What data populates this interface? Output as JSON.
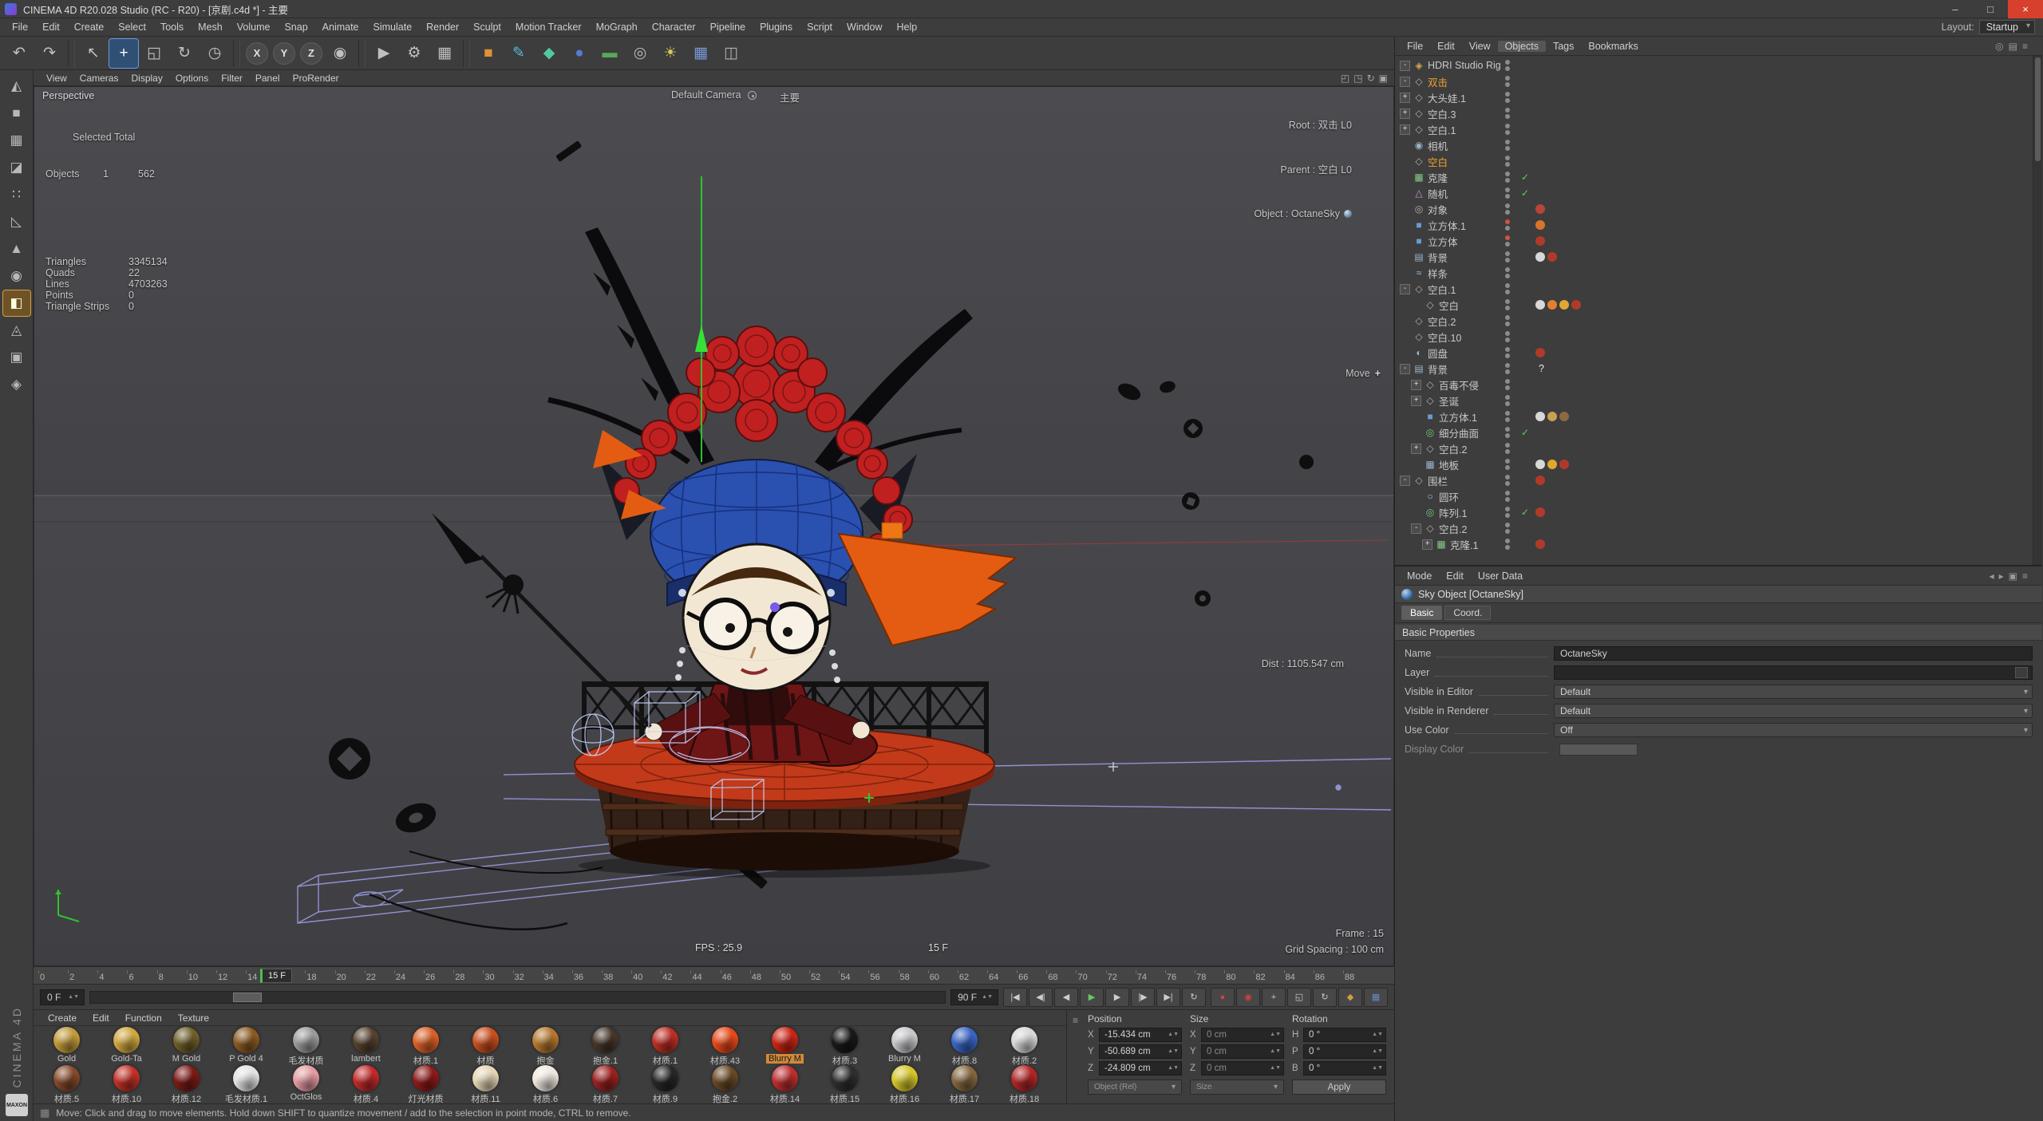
{
  "window": {
    "title": "CINEMA 4D R20.028 Studio (RC - R20) - [京剧.c4d *] - 主要",
    "buttons": [
      {
        "n": "minimize-button",
        "g": "–"
      },
      {
        "n": "maximize-button",
        "g": "□"
      },
      {
        "n": "close-button",
        "g": "×",
        "k": "close"
      }
    ]
  },
  "menubar": {
    "items": [
      "File",
      "Edit",
      "Create",
      "Select",
      "Tools",
      "Mesh",
      "Volume",
      "Snap",
      "Animate",
      "Simulate",
      "Render",
      "Sculpt",
      "Motion Tracker",
      "MoGraph",
      "Character",
      "Pipeline",
      "Plugins",
      "Script",
      "Window",
      "Help"
    ],
    "layout_label": "Layout:",
    "layout_value": "Startup"
  },
  "toolbar": {
    "items": [
      {
        "n": "undo-icon",
        "g": "↶"
      },
      {
        "n": "redo-icon",
        "g": "↷"
      },
      {
        "k": "sep"
      },
      {
        "n": "live-selection-icon",
        "g": "↖"
      },
      {
        "n": "move-tool-icon",
        "g": "+",
        "k": "active"
      },
      {
        "n": "scale-tool-icon",
        "g": "◱"
      },
      {
        "n": "rotate-tool-icon",
        "g": "↻"
      },
      {
        "n": "last-tool-icon",
        "g": "◷"
      },
      {
        "k": "sep"
      },
      {
        "n": "lock-x-axis",
        "g": "X",
        "k": "axis"
      },
      {
        "n": "lock-y-axis",
        "g": "Y",
        "k": "axis"
      },
      {
        "n": "lock-z-axis",
        "g": "Z",
        "k": "axis"
      },
      {
        "n": "coord-system-icon",
        "g": "◉"
      },
      {
        "k": "sep"
      },
      {
        "n": "render-view-icon",
        "g": "▶"
      },
      {
        "n": "render-settings-icon",
        "g": "⚙"
      },
      {
        "n": "render-queue-icon",
        "g": "▦"
      },
      {
        "k": "sep"
      },
      {
        "n": "primitive-cube-icon",
        "g": "■",
        "c": "#e09038"
      },
      {
        "n": "spline-pen-icon",
        "g": "✎",
        "c": "#58b8d8"
      },
      {
        "n": "mograph-icon",
        "g": "◆",
        "c": "#50c8a0"
      },
      {
        "n": "deformer-icon",
        "g": "●",
        "c": "#5878d8"
      },
      {
        "n": "environment-icon",
        "g": "▬",
        "c": "#58a858"
      },
      {
        "n": "camera-tool-icon",
        "g": "◎",
        "c": "#b8b8b8"
      },
      {
        "n": "light-tool-icon",
        "g": "☀",
        "c": "#d8c858"
      },
      {
        "n": "array-tool-icon",
        "g": "▦",
        "c": "#7898d8"
      },
      {
        "n": "display-mode-icon",
        "g": "◫",
        "c": "#b0b0b0"
      }
    ]
  },
  "side_toolbar": {
    "items": [
      {
        "n": "make-editable-icon",
        "g": "◭"
      },
      {
        "n": "model-mode-icon",
        "g": "■"
      },
      {
        "n": "texture-mode-icon",
        "g": "▦"
      },
      {
        "n": "workplane-mode-icon",
        "g": "◪"
      },
      {
        "n": "points-mode-icon",
        "g": "∷"
      },
      {
        "n": "edges-mode-icon",
        "g": "◺"
      },
      {
        "n": "polygons-mode-icon",
        "g": "▲"
      },
      {
        "n": "enable-axis-icon",
        "g": "◉"
      },
      {
        "n": "viewport-solo-icon",
        "g": "◧",
        "k": "active"
      },
      {
        "n": "snap-icon",
        "g": "◬"
      },
      {
        "n": "lock-workplane-icon",
        "g": "▣"
      },
      {
        "n": "quantize-icon",
        "g": "◈"
      }
    ]
  },
  "viewport": {
    "menu": [
      "View",
      "Cameras",
      "Display",
      "Options",
      "Filter",
      "Panel",
      "ProRender"
    ],
    "right_icons": [
      {
        "n": "pan-view-icon",
        "g": "◰"
      },
      {
        "n": "zoom-view-icon",
        "g": "◳"
      },
      {
        "n": "rotate-view-icon",
        "g": "↻"
      },
      {
        "n": "toggle-views-icon",
        "g": "▣"
      }
    ],
    "view_label": "Perspective",
    "camera_label": "Default Camera",
    "camera_tag": "主要",
    "hud": {
      "root": "Root : 双击 L0",
      "parent": "Parent : 空白 L0",
      "object": "Object : OctaneSky",
      "move": "Move",
      "dist": "Dist : 1105.547 cm",
      "fps": "FPS : 25.9",
      "frame_center": "15 F",
      "frame": "Frame : 15",
      "grid": "Grid Spacing : 100 cm"
    },
    "stats": {
      "title": "Selected Total",
      "objects_label": "Objects",
      "objects_sel": "1",
      "objects_total": "562",
      "rows": [
        [
          "Triangles",
          "3345134"
        ],
        [
          "Quads",
          "22"
        ],
        [
          "Lines",
          "4703263"
        ],
        [
          "Points",
          "0"
        ],
        [
          "Triangle Strips",
          "0"
        ]
      ]
    }
  },
  "timeline": {
    "ticks": [
      "0",
      "2",
      "4",
      "6",
      "8",
      "10",
      "12",
      "14",
      "16",
      "18",
      "20",
      "22",
      "24",
      "26",
      "28",
      "30",
      "32",
      "34",
      "36",
      "38",
      "40",
      "42",
      "44",
      "46",
      "48",
      "50",
      "52",
      "54",
      "56",
      "58",
      "60",
      "62",
      "64",
      "66",
      "68",
      "70",
      "72",
      "74",
      "76",
      "78",
      "80",
      "82",
      "84",
      "86",
      "88"
    ],
    "marker": "15 F",
    "start": "0 F",
    "end": "90 F",
    "transport": [
      {
        "n": "goto-start-icon",
        "g": "|◀"
      },
      {
        "n": "prev-key-icon",
        "g": "◀|"
      },
      {
        "n": "prev-frame-icon",
        "g": "◀"
      },
      {
        "n": "play-icon",
        "g": "▶",
        "c": "#68c868"
      },
      {
        "n": "next-frame-icon",
        "g": "▶"
      },
      {
        "n": "next-key-icon",
        "g": "|▶"
      },
      {
        "n": "goto-end-icon",
        "g": "▶|"
      },
      {
        "n": "loop-icon",
        "g": "↻"
      }
    ],
    "record": [
      {
        "n": "record-keyframe-icon",
        "g": "●",
        "c": "#d24040"
      },
      {
        "n": "autokey-icon",
        "g": "◉",
        "c": "#d24040"
      },
      {
        "n": "record-position-icon",
        "g": "+",
        "c": "#c8c8c8"
      },
      {
        "n": "record-scale-icon",
        "g": "◱",
        "c": "#c8c8c8"
      },
      {
        "n": "record-rotation-icon",
        "g": "↻",
        "c": "#c8c8c8"
      },
      {
        "n": "record-parameter-icon",
        "g": "◆",
        "c": "#d0a040"
      },
      {
        "n": "record-pla-icon",
        "g": "▦",
        "c": "#6888c8"
      }
    ]
  },
  "materials": {
    "menu": [
      "Create",
      "Edit",
      "Function",
      "Texture"
    ],
    "items": [
      {
        "n": "Gold",
        "c": "#c09a3a"
      },
      {
        "n": "Gold-Ta",
        "c": "#cfa63f"
      },
      {
        "n": "M Gold",
        "c": "#6e5e2a"
      },
      {
        "n": "P Gold 4",
        "c": "#8a5a22"
      },
      {
        "n": "毛发材质",
        "c": "#9a9a9a"
      },
      {
        "n": "lambert",
        "c": "#54422e"
      },
      {
        "n": "材质.1",
        "c": "#d96026"
      },
      {
        "n": "材质",
        "c": "#c84e1e"
      },
      {
        "n": "抱金",
        "c": "#b5762f"
      },
      {
        "n": "抱金.1",
        "c": "#46362a"
      },
      {
        "n": "材质.1",
        "c": "#bb2e24"
      },
      {
        "n": "材质.43",
        "c": "#e8491a"
      },
      {
        "n": "Blurry M",
        "c": "#cc2414",
        "sc": "sel"
      },
      {
        "n": "材质.3",
        "c": "#181818"
      },
      {
        "n": "Blurry M",
        "c": "#c6c6ca"
      },
      {
        "n": "材质.8",
        "c": "#3a64c4"
      },
      {
        "n": "材质.2",
        "c": "#d6d6d6"
      },
      {
        "n": "材质.5",
        "c": "#84492a"
      },
      {
        "n": "材质.10",
        "c": "#c23026"
      },
      {
        "n": "材质.12",
        "c": "#7c1a16"
      },
      {
        "n": "毛发材质.1",
        "c": "#e2e2e2"
      },
      {
        "n": "OctGlos",
        "c": "#e49aa2"
      },
      {
        "n": "材质.4",
        "c": "#c22a2a"
      },
      {
        "n": "灯光材质",
        "c": "#8e1a1a"
      },
      {
        "n": "材质.11",
        "c": "#e4d4b4"
      },
      {
        "n": "材质.6",
        "c": "#efe7de"
      },
      {
        "n": "材质.7",
        "c": "#9c2020"
      },
      {
        "n": "材质.9",
        "c": "#262626"
      },
      {
        "n": "抱金.2",
        "c": "#684826"
      },
      {
        "n": "材质.14",
        "c": "#bd2e2e"
      },
      {
        "n": "材质.15",
        "c": "#2e2e2e"
      },
      {
        "n": "材质.16",
        "c": "#d4c42a"
      },
      {
        "n": "材质.17",
        "c": "#84663e"
      },
      {
        "n": "材质.18",
        "c": "#b22626"
      }
    ]
  },
  "coordinates": {
    "groups": [
      {
        "title": "Position",
        "l1": "X",
        "v1": "-15.434 cm",
        "l2": "Y",
        "v2": "-50.689 cm",
        "l3": "Z",
        "v3": "-24.809 cm",
        "foot": "Object (Rel)",
        "ft": "dd"
      },
      {
        "title": "Size",
        "l1": "X",
        "v1": "0 cm",
        "l2": "Y",
        "v2": "0 cm",
        "l3": "Z",
        "v3": "0 cm",
        "foot": "Size",
        "ft": "dd",
        "vcls": "dim"
      },
      {
        "title": "Rotation",
        "l1": "H",
        "v1": "0 °",
        "l2": "P",
        "v2": "0 °",
        "l3": "B",
        "v3": "0 °",
        "foot": "Apply",
        "ft": "btn"
      }
    ]
  },
  "object_manager": {
    "menu": [
      {
        "t": "File"
      },
      {
        "t": "Edit"
      },
      {
        "t": "View"
      },
      {
        "t": "Objects",
        "k": "active"
      },
      {
        "t": "Tags"
      },
      {
        "t": "Bookmarks"
      }
    ],
    "right_icons": [
      {
        "n": "search-icon",
        "g": "◎"
      },
      {
        "n": "filter-icon",
        "g": "▤"
      },
      {
        "n": "panel-menu-icon",
        "g": "≡"
      }
    ],
    "tree": [
      {
        "eb": "on",
        "e": "-",
        "g": "◈",
        "gc": "#d8a848",
        "l": "HDRI Studio Rig"
      },
      {
        "eb": "on",
        "e": "-",
        "g": "◇",
        "l": "双击",
        "lc": "sel"
      },
      {
        "eb": "on",
        "e": "+",
        "g": "◇",
        "l": "大头娃.1"
      },
      {
        "eb": "on",
        "e": "+",
        "g": "◇",
        "l": "空白.3"
      },
      {
        "eb": "on",
        "e": "+",
        "g": "◇",
        "l": "空白.1"
      },
      {
        "g": "◉",
        "gc": "#9ab4c8",
        "l": "相机"
      },
      {
        "g": "◇",
        "l": "空白",
        "lc": "sel"
      },
      {
        "g": "▦",
        "gc": "#88c888",
        "l": "克隆",
        "ck": "✓"
      },
      {
        "g": "△",
        "gc": "#c898c8",
        "l": "随机",
        "ck": "✓"
      },
      {
        "g": "◎",
        "gc": "#b0b0b0",
        "l": "对象",
        "t1": "#b8443a"
      },
      {
        "g": "■",
        "gc": "#6a9ad4",
        "l": "立方体.1",
        "t1": "#d8742a",
        "d1": "#cc5544"
      },
      {
        "g": "■",
        "gc": "#6a9ad4",
        "l": "立方体",
        "t1": "#b03a2a",
        "d1": "#cc5544"
      },
      {
        "g": "▤",
        "gc": "#9ab4c8",
        "l": "背景",
        "t1": "#d8d8d8",
        "t2": "#b03a2a"
      },
      {
        "g": "≈",
        "gc": "#98c8e8",
        "l": "样条"
      },
      {
        "eb": "on",
        "e": "-",
        "g": "◇",
        "l": "空白.1"
      },
      {
        "ind": "14px",
        "g": "◇",
        "l": "空白",
        "t1": "#d8d8d8",
        "t2": "#e08030",
        "t3": "#e0a830",
        "t4": "#b03a2a"
      },
      {
        "g": "◇",
        "l": "空白.2"
      },
      {
        "g": "◇",
        "l": "空白.10"
      },
      {
        "g": "◐",
        "gc": "#9ab4c8",
        "l": "圆盘",
        "t1": "#b03a2a"
      },
      {
        "eb": "on",
        "e": "-",
        "g": "▤",
        "gc": "#9ab4c8",
        "l": "背景",
        "q": "?"
      },
      {
        "ind": "14px",
        "eb": "on",
        "e": "+",
        "g": "◇",
        "l": "百毒不侵"
      },
      {
        "ind": "14px",
        "eb": "on",
        "e": "+",
        "g": "◇",
        "l": "圣诞"
      },
      {
        "ind": "14px",
        "g": "■",
        "gc": "#6a9ad4",
        "l": "立方体.1",
        "t1": "#d8d8d8",
        "t2": "#c8a050",
        "t3": "#8a6a40"
      },
      {
        "ind": "14px",
        "g": "◎",
        "gc": "#78c878",
        "l": "细分曲面",
        "ck": "✓"
      },
      {
        "ind": "14px",
        "eb": "on",
        "e": "+",
        "g": "◇",
        "l": "空白.2"
      },
      {
        "ind": "14px",
        "g": "▦",
        "gc": "#9ab4c8",
        "l": "地板",
        "t1": "#d8d8d8",
        "t2": "#e0a830",
        "t3": "#b03a2a"
      },
      {
        "eb": "on",
        "e": "-",
        "g": "◇",
        "l": "围栏",
        "t1": "#b03a2a"
      },
      {
        "ind": "14px",
        "g": "○",
        "gc": "#98c8e8",
        "l": "圆环"
      },
      {
        "ind": "14px",
        "g": "◎",
        "gc": "#78c878",
        "l": "阵列.1",
        "ck": "✓",
        "t1": "#b03a2a"
      },
      {
        "ind": "14px",
        "eb": "on",
        "e": "-",
        "g": "◇",
        "l": "空白.2"
      },
      {
        "ind": "28px",
        "eb": "on",
        "e": "+",
        "g": "▦",
        "gc": "#88c888",
        "l": "克隆.1",
        "t1": "#b03a2a"
      }
    ]
  },
  "attributes": {
    "menu": [
      "Mode",
      "Edit",
      "User Data"
    ],
    "right_icons": [
      {
        "n": "history-back-icon",
        "g": "◂"
      },
      {
        "n": "history-forward-icon",
        "g": "▸"
      },
      {
        "n": "lock-icon",
        "g": "▣"
      },
      {
        "n": "panel-menu-icon",
        "g": "≡"
      }
    ],
    "title": "Sky Object [OctaneSky]",
    "tabs": [
      {
        "t": "Basic",
        "k": "active"
      },
      {
        "t": "Coord."
      }
    ],
    "section": "Basic Properties",
    "rows": [
      {
        "label": "Name",
        "value": "OctaneSky",
        "type": "t-text"
      },
      {
        "label": "Layer",
        "value": "",
        "type": "t-layer"
      },
      {
        "label": "Visible in Editor",
        "value": "Default",
        "type": "t-dd"
      },
      {
        "label": "Visible in Renderer",
        "value": "Default",
        "type": "t-dd"
      },
      {
        "label": "Use Color",
        "value": "Off",
        "type": "t-dd"
      },
      {
        "label": "Display Color",
        "value": "",
        "type": "t-color",
        "lcls": "dim"
      }
    ]
  },
  "statusbar": {
    "icon": "▦",
    "text": "Move: Click and drag to move elements. Hold down SHIFT to quantize movement / add to the selection in point mode, CTRL to remove."
  },
  "branding": {
    "vertical": "CINEMA 4D",
    "logo": "MAXON"
  }
}
